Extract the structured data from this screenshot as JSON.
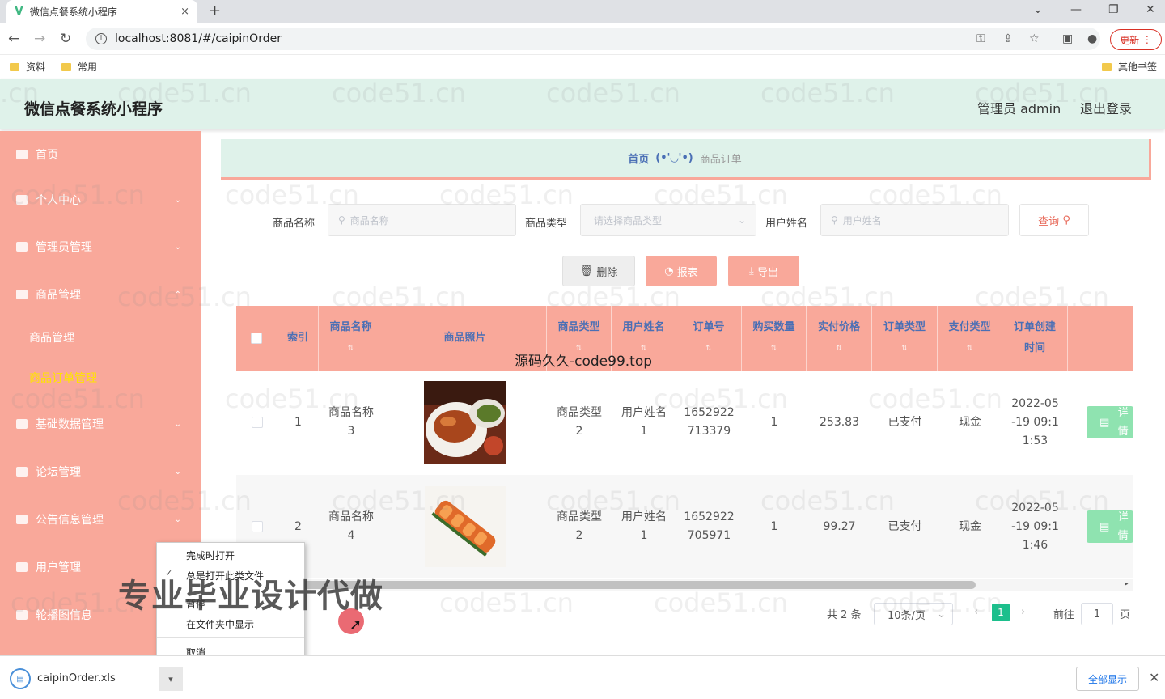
{
  "browser": {
    "tab_title": "微信点餐系统小程序",
    "tab_close": "×",
    "new_tab": "+",
    "url": "localhost:8081/#/caipinOrder",
    "update_label": "更新",
    "bookmarks": [
      "资料",
      "常用"
    ],
    "other_bookmarks": "其他书签"
  },
  "app": {
    "title": "微信点餐系统小程序",
    "admin": "管理员 admin",
    "logout": "退出登录"
  },
  "sidebar": {
    "items": [
      {
        "label": "首页"
      },
      {
        "label": "个人中心"
      },
      {
        "label": "管理员管理"
      },
      {
        "label": "商品管理"
      },
      {
        "label": "商品管理"
      },
      {
        "label": "商品订单管理"
      },
      {
        "label": "基础数据管理"
      },
      {
        "label": "论坛管理"
      },
      {
        "label": "公告信息管理"
      },
      {
        "label": "用户管理"
      },
      {
        "label": "轮播图信息"
      }
    ]
  },
  "breadcrumb": {
    "home": "首页",
    "face": "(•'◡'•)",
    "current": "商品订单"
  },
  "filters": {
    "name_label": "商品名称",
    "name_placeholder": "商品名称",
    "type_label": "商品类型",
    "type_placeholder": "请选择商品类型",
    "user_label": "用户姓名",
    "user_placeholder": "用户姓名",
    "query": "查询"
  },
  "actions": {
    "delete": "删除",
    "report": "报表",
    "export": "导出"
  },
  "table": {
    "headers": [
      "索引",
      "商品名称",
      "商品照片",
      "商品类型",
      "用户姓名",
      "订单号",
      "购买数量",
      "实付价格",
      "订单类型",
      "支付类型",
      "订单创建时间"
    ],
    "header_created_l1": "订单创建",
    "header_created_l2": "时间",
    "rows": [
      {
        "index": "1",
        "name_l1": "商品名称",
        "name_l2": "3",
        "type_l1": "商品类型",
        "type_l2": "2",
        "user_l1": "用户姓名",
        "user_l2": "1",
        "order_l1": "1652922",
        "order_l2": "713379",
        "qty": "1",
        "price": "253.83",
        "order_type": "已支付",
        "pay_type": "现金",
        "time_l1": "2022-05",
        "time_l2": "-19 09:1",
        "time_l3": "1:53",
        "detail": "详情"
      },
      {
        "index": "2",
        "name_l1": "商品名称",
        "name_l2": "4",
        "type_l1": "商品类型",
        "type_l2": "2",
        "user_l1": "用户姓名",
        "user_l2": "1",
        "order_l1": "1652922",
        "order_l2": "705971",
        "qty": "1",
        "price": "99.27",
        "order_type": "已支付",
        "pay_type": "现金",
        "time_l1": "2022-05",
        "time_l2": "-19 09:1",
        "time_l3": "1:46",
        "detail": "详情"
      }
    ]
  },
  "pagination": {
    "total": "共 2 条",
    "page_size": "10条/页",
    "current": "1",
    "goto": "前往",
    "goto_value": "1",
    "page_unit": "页"
  },
  "overlays": {
    "source_watermark": "源码久久-code99.top",
    "promo": "专业毕业设计代做",
    "watermark": "code51.cn"
  },
  "context_menu": {
    "items": [
      "完成时打开",
      "总是打开此类文件",
      "暂停",
      "在文件夹中显示",
      "取消"
    ]
  },
  "downloads": {
    "filename": "caipinOrder.xls",
    "show_all": "全部显示"
  },
  "colors": {
    "sidebar": "#f9a89a",
    "header": "#dff2ea",
    "accent_text": "#4a6fb5",
    "active": "#ffe400",
    "page_current": "#1cbf8c"
  }
}
